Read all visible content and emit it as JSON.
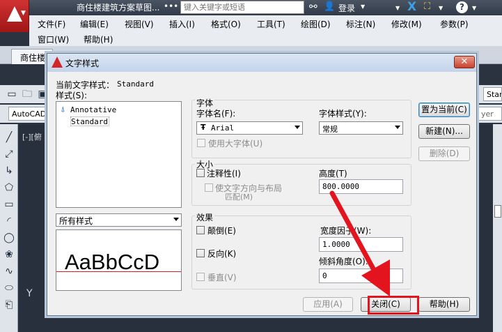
{
  "app": {
    "title": "商住楼建筑方案草图...",
    "title_ellipsis": "•••",
    "search_placeholder": "键入关键字或短语",
    "login_label": "登录",
    "help_label": "?"
  },
  "menubar": {
    "items": [
      "文件(F)",
      "编辑(E)",
      "视图(V)",
      "插入(I)",
      "格式(O)",
      "工具(T)",
      "绘图(D)",
      "标注(N)",
      "修改(M)",
      "参数(P)",
      "窗口(W)",
      "帮助(H)"
    ]
  },
  "doc_tab": "商住楼",
  "background": {
    "style_combo": "AutoCAD",
    "right_combo_top": "Star",
    "right_combo_mid": "yer",
    "viewport_label": "[-][俯",
    "ucs_y": "Y"
  },
  "dialog": {
    "title": "文字样式",
    "close_label": "✕",
    "current_style_label": "当前文字样式：",
    "current_style_value": "Standard",
    "styles_label": "样式(S):",
    "styles": [
      {
        "name": "Annotative",
        "annotative": true
      },
      {
        "name": "Standard",
        "annotative": false
      }
    ],
    "filter_value": "所有样式",
    "preview_text": "AaBbCcD",
    "font_group": "字体",
    "font_name_label": "字体名(F):",
    "font_name_value": "Arial",
    "font_style_label": "字体样式(Y):",
    "font_style_value": "常规",
    "big_font_label": "使用大字体(U)",
    "size_group": "大小",
    "annotative_label": "注释性(I)",
    "match_orient_label_1": "使文字方向与布局",
    "match_orient_label_2": "匹配(M)",
    "height_label": "高度(T)",
    "height_value": "800.0000",
    "effects_group": "效果",
    "upside_down_label": "颠倒(E)",
    "backwards_label": "反向(K)",
    "vertical_label": "垂直(V)",
    "width_factor_label": "宽度因子(W):",
    "width_factor_value": "1.0000",
    "oblique_label": "倾斜角度(O):",
    "oblique_value": "0",
    "set_current_label": "置为当前(C)",
    "new_label": "新建(N)...",
    "delete_label": "删除(D)",
    "apply_label": "应用(A)",
    "close_btn_label": "关闭(C)",
    "help_btn_label": "帮助(H)"
  },
  "colors": {
    "annotation_arrow": "#e4141e",
    "autocad_red": "#c81e1e",
    "drawing_background": "#27303c"
  }
}
